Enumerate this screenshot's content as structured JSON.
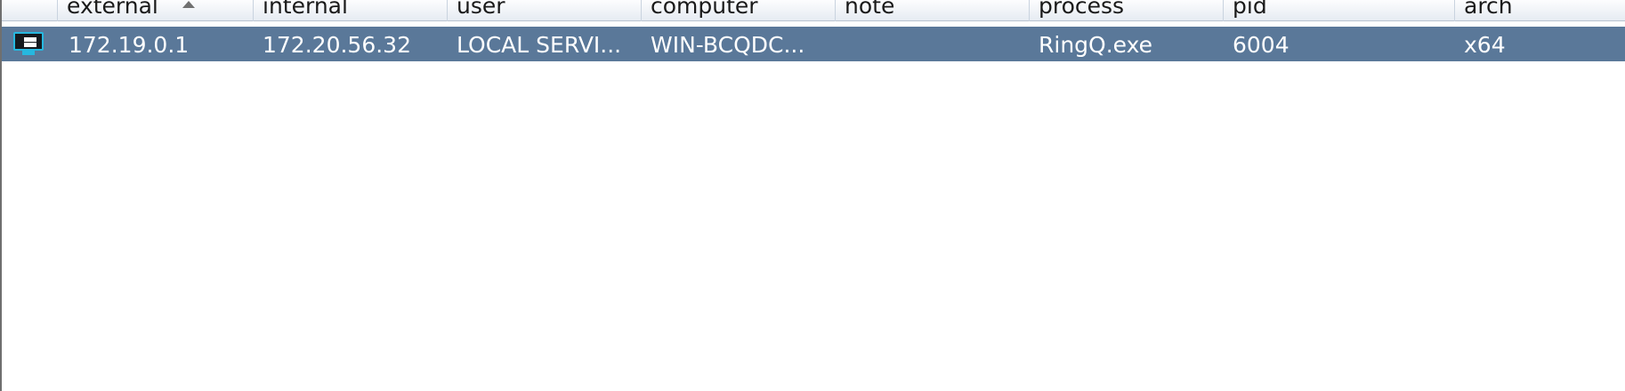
{
  "columns": [
    {
      "key": "external",
      "label": "external",
      "sorted": "ascending"
    },
    {
      "key": "internal",
      "label": "internal"
    },
    {
      "key": "user",
      "label": "user"
    },
    {
      "key": "computer",
      "label": "computer"
    },
    {
      "key": "note",
      "label": "note"
    },
    {
      "key": "process",
      "label": "process"
    },
    {
      "key": "pid",
      "label": "pid"
    },
    {
      "key": "arch",
      "label": "arch"
    }
  ],
  "rows": [
    {
      "icon": "windows-monitor-icon",
      "selected": true,
      "external": "172.19.0.1",
      "internal": "172.20.56.32",
      "user": "LOCAL SERVI...",
      "computer": "WIN-BCQDC...",
      "note": "",
      "process": "RingQ.exe",
      "pid": "6004",
      "arch": "x64"
    }
  ],
  "colors": {
    "selected_row": "#5a7899",
    "header_top": "#fdfdfe",
    "header_bottom": "#e6ebf2",
    "icon_accent": "#26b8e0"
  }
}
